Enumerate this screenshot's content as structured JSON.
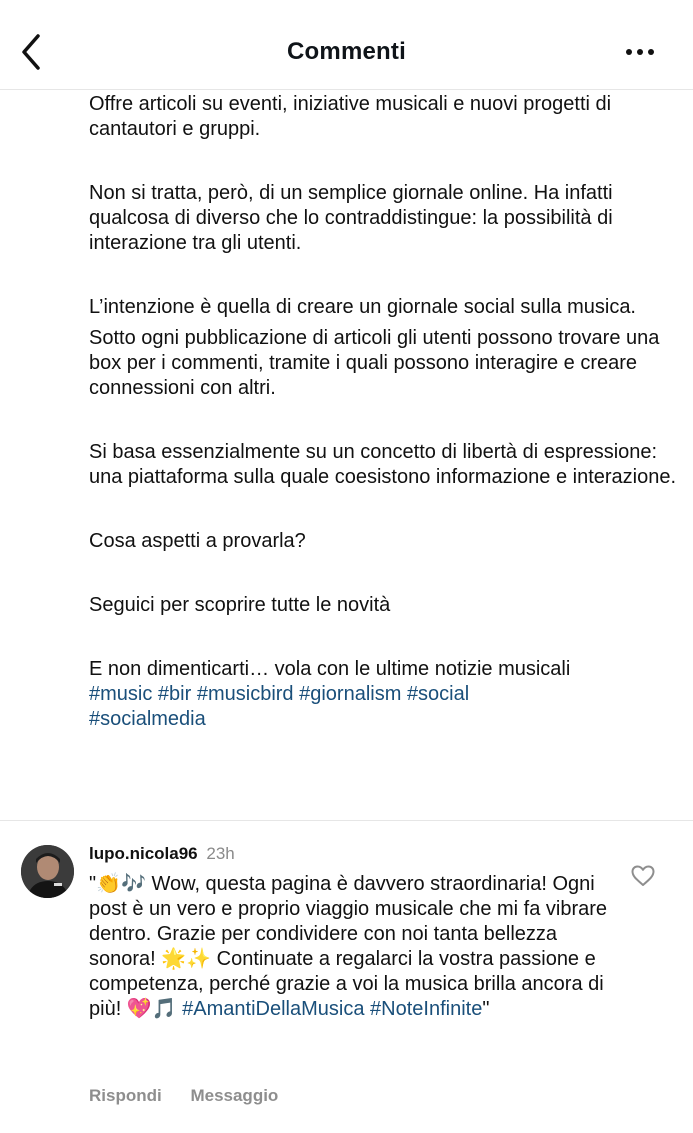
{
  "header": {
    "title": "Commenti"
  },
  "caption": {
    "paragraphs": [
      "Offre articoli su eventi, iniziative musicali e nuovi progetti di cantautori e gruppi.",
      "Non si tratta, però, di un semplice giornale online. Ha infatti qualcosa di diverso che lo contraddistingue: la possibilità di interazione tra gli utenti.",
      "L’intenzione è quella di creare un giornale social sulla musica.",
      "Sotto ogni pubblicazione di articoli gli utenti possono trovare una box per i commenti, tramite i quali possono interagire e creare connessioni con altri.",
      "Si basa essenzialmente su un concetto di libertà di espressione: una piattaforma sulla quale coesistono informazione e interazione.",
      "Cosa aspetti a provarla?",
      "Seguici per scoprire tutte le novità",
      "E non dimenticarti… vola con le ultime notizie musicali"
    ],
    "hashtags": [
      "#music",
      "#bir",
      "#musicbird",
      "#giornalism",
      "#social",
      "#socialmedia"
    ]
  },
  "comment": {
    "username": "lupo.nicola96",
    "time": "23h",
    "text_part1": "\"👏🎶 Wow, questa pagina è davvero straordinaria! Ogni post è un vero e proprio viaggio musicale che mi fa vibrare dentro. Grazie per condividere con noi tanta bellezza sonora! 🌟✨ Continuate a regalarci la vostra passione e competenza, perché grazie a voi la musica brilla ancora di più! 💖🎵 ",
    "hashtag1": "#AmantiDellaMusica",
    "hashtag2": "#NoteInfinite",
    "text_end": "\"",
    "reply_label": "Rispondi",
    "message_label": "Messaggio"
  },
  "colors": {
    "link": "#1a4f7a",
    "muted": "#8e8e8e",
    "divider": "#e6e6e6"
  }
}
